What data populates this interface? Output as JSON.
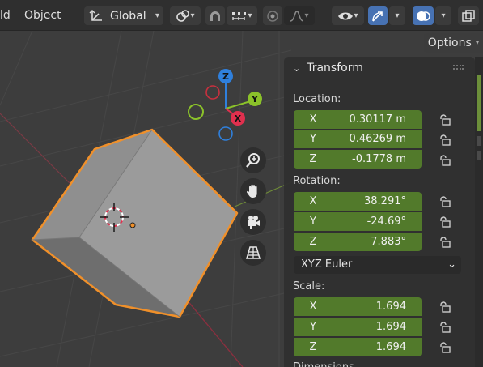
{
  "header": {
    "menu_view_partial": "ld",
    "menu_object": "Object",
    "orientation": "Global"
  },
  "options_label": "Options",
  "panel": {
    "section_title": "Transform",
    "location": {
      "label": "Location:",
      "x": {
        "axis": "X",
        "value": "0.30117 m"
      },
      "y": {
        "axis": "Y",
        "value": "0.46269 m"
      },
      "z": {
        "axis": "Z",
        "value": "-0.1778 m"
      }
    },
    "rotation": {
      "label": "Rotation:",
      "x": {
        "axis": "X",
        "value": "38.291°"
      },
      "y": {
        "axis": "Y",
        "value": "-24.69°"
      },
      "z": {
        "axis": "Z",
        "value": "7.883°"
      },
      "mode": "XYZ Euler"
    },
    "scale": {
      "label": "Scale:",
      "x": {
        "axis": "X",
        "value": "1.694"
      },
      "y": {
        "axis": "Y",
        "value": "1.694"
      },
      "z": {
        "axis": "Z",
        "value": "1.694"
      }
    },
    "dimensions_label_partial": "Dimensions"
  },
  "gizmo": {
    "x_label": "X",
    "y_label": "Y",
    "z_label": "Z",
    "x_color": "#e0304e",
    "y_color": "#8bc22a",
    "z_color": "#2f80dd"
  },
  "colors": {
    "accent": "#4772b3",
    "field_green": "#527a2b",
    "selection_orange": "#f0902a"
  },
  "icons": [
    "transform-pivot-icon",
    "snap-magnet-icon",
    "snap-increment-icon",
    "proportional-edit-icon",
    "falloff-curve-icon",
    "visibility-eye-icon",
    "gizmo-icon",
    "overlay-icon",
    "xray-icon",
    "zoom-icon",
    "hand-pan-icon",
    "camera-icon",
    "perspective-grid-icon",
    "lock-icon"
  ]
}
